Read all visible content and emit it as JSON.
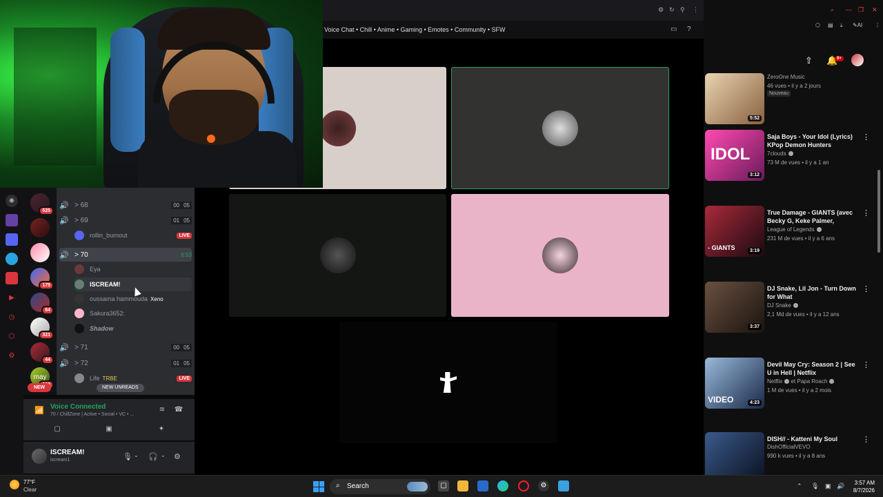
{
  "discord": {
    "topic": "Voice Chat • Chill • Anime • Gaming • Emotes • Community • SFW",
    "server_badges": [
      "525",
      "175",
      "64",
      "321",
      "44",
      "100"
    ],
    "server_text": "may",
    "new_badge": "NEW",
    "channels": [
      {
        "name": "> 68",
        "counts": [
          "00",
          "05"
        ],
        "speaker": "active"
      },
      {
        "name": "> 69",
        "counts": [
          "01",
          "05"
        ],
        "speaker": "active"
      },
      {
        "name": "> 70",
        "timer": "6:53",
        "speaker": "active",
        "selected": true
      },
      {
        "name": "> 71",
        "counts": [
          "00",
          "05"
        ],
        "speaker": "grey"
      },
      {
        "name": "> 72",
        "counts": [
          "01",
          "05"
        ],
        "speaker": "active"
      }
    ],
    "users_69": [
      {
        "name": "rollin_burnout",
        "live": "LIVE"
      }
    ],
    "users_70": [
      {
        "name": "Eya"
      },
      {
        "name": "ISCREAM!"
      },
      {
        "name": "oussama hammouda",
        "tag": "Xeno"
      },
      {
        "name": "Sakura3652:"
      },
      {
        "name": "Shadow"
      }
    ],
    "users_72": [
      {
        "name": "Life",
        "tag": "TRBE",
        "live": "LIVE"
      }
    ],
    "new_unreads": "NEW UNREADS",
    "voice": {
      "title": "Voice Connected",
      "subtitle": "70 / ChillZone | Active • Social • VC • ..."
    },
    "user": {
      "name": "ISCREAM!",
      "tag": "iscream1"
    }
  },
  "youtube": {
    "notif_count": "9+",
    "videos": [
      {
        "title": "",
        "channel": "ZeroOne Music",
        "meta": "46 vues • il y a 2 jours",
        "new_tag": "Nouveau",
        "duration": "5:52",
        "thumb": "#c9a88a"
      },
      {
        "title": "Saja Boys - Your Idol (Lyrics) KPop Demon Hunters",
        "channel": "7clouds",
        "meta": "73 M de vues • il y a 1 an",
        "duration": "3:12",
        "thumb": "#d43a8a",
        "thumb_text": "IDOL"
      },
      {
        "title": "True Damage - GIANTS (avec Becky G, Keke Palmer, SOYEO...",
        "channel": "League of Legends",
        "meta": "231 M de vues • il y a 6 ans",
        "duration": "3:19",
        "thumb": "#5a1a24",
        "thumb_text": "- GIANTS"
      },
      {
        "title": "DJ Snake, Lil Jon - Turn Down for What",
        "channel": "DJ Snake",
        "meta": "2,1 Md de vues • il y a 12 ans",
        "duration": "3:37",
        "thumb": "#3a2a22"
      },
      {
        "title": "Devil May Cry: Season 2 | See U in Hell | Netflix",
        "channel": "Netflix",
        "channel_extra": "et Papa Roach",
        "meta": "1 M de vues • il y a 2 mois",
        "duration": "4:23",
        "thumb": "#2a4a6a",
        "thumb_text": "VIDEO"
      },
      {
        "title": "DISH// - Katteni My Soul",
        "channel": "DishOfficialVEVO",
        "meta": "990 k vues • il y a 8 ans",
        "thumb": "#1a2a4a"
      }
    ]
  },
  "taskbar": {
    "temp": "77°F",
    "condition": "Clear",
    "search": "Search",
    "time": "3:57 AM",
    "date": "8/7/2026"
  }
}
